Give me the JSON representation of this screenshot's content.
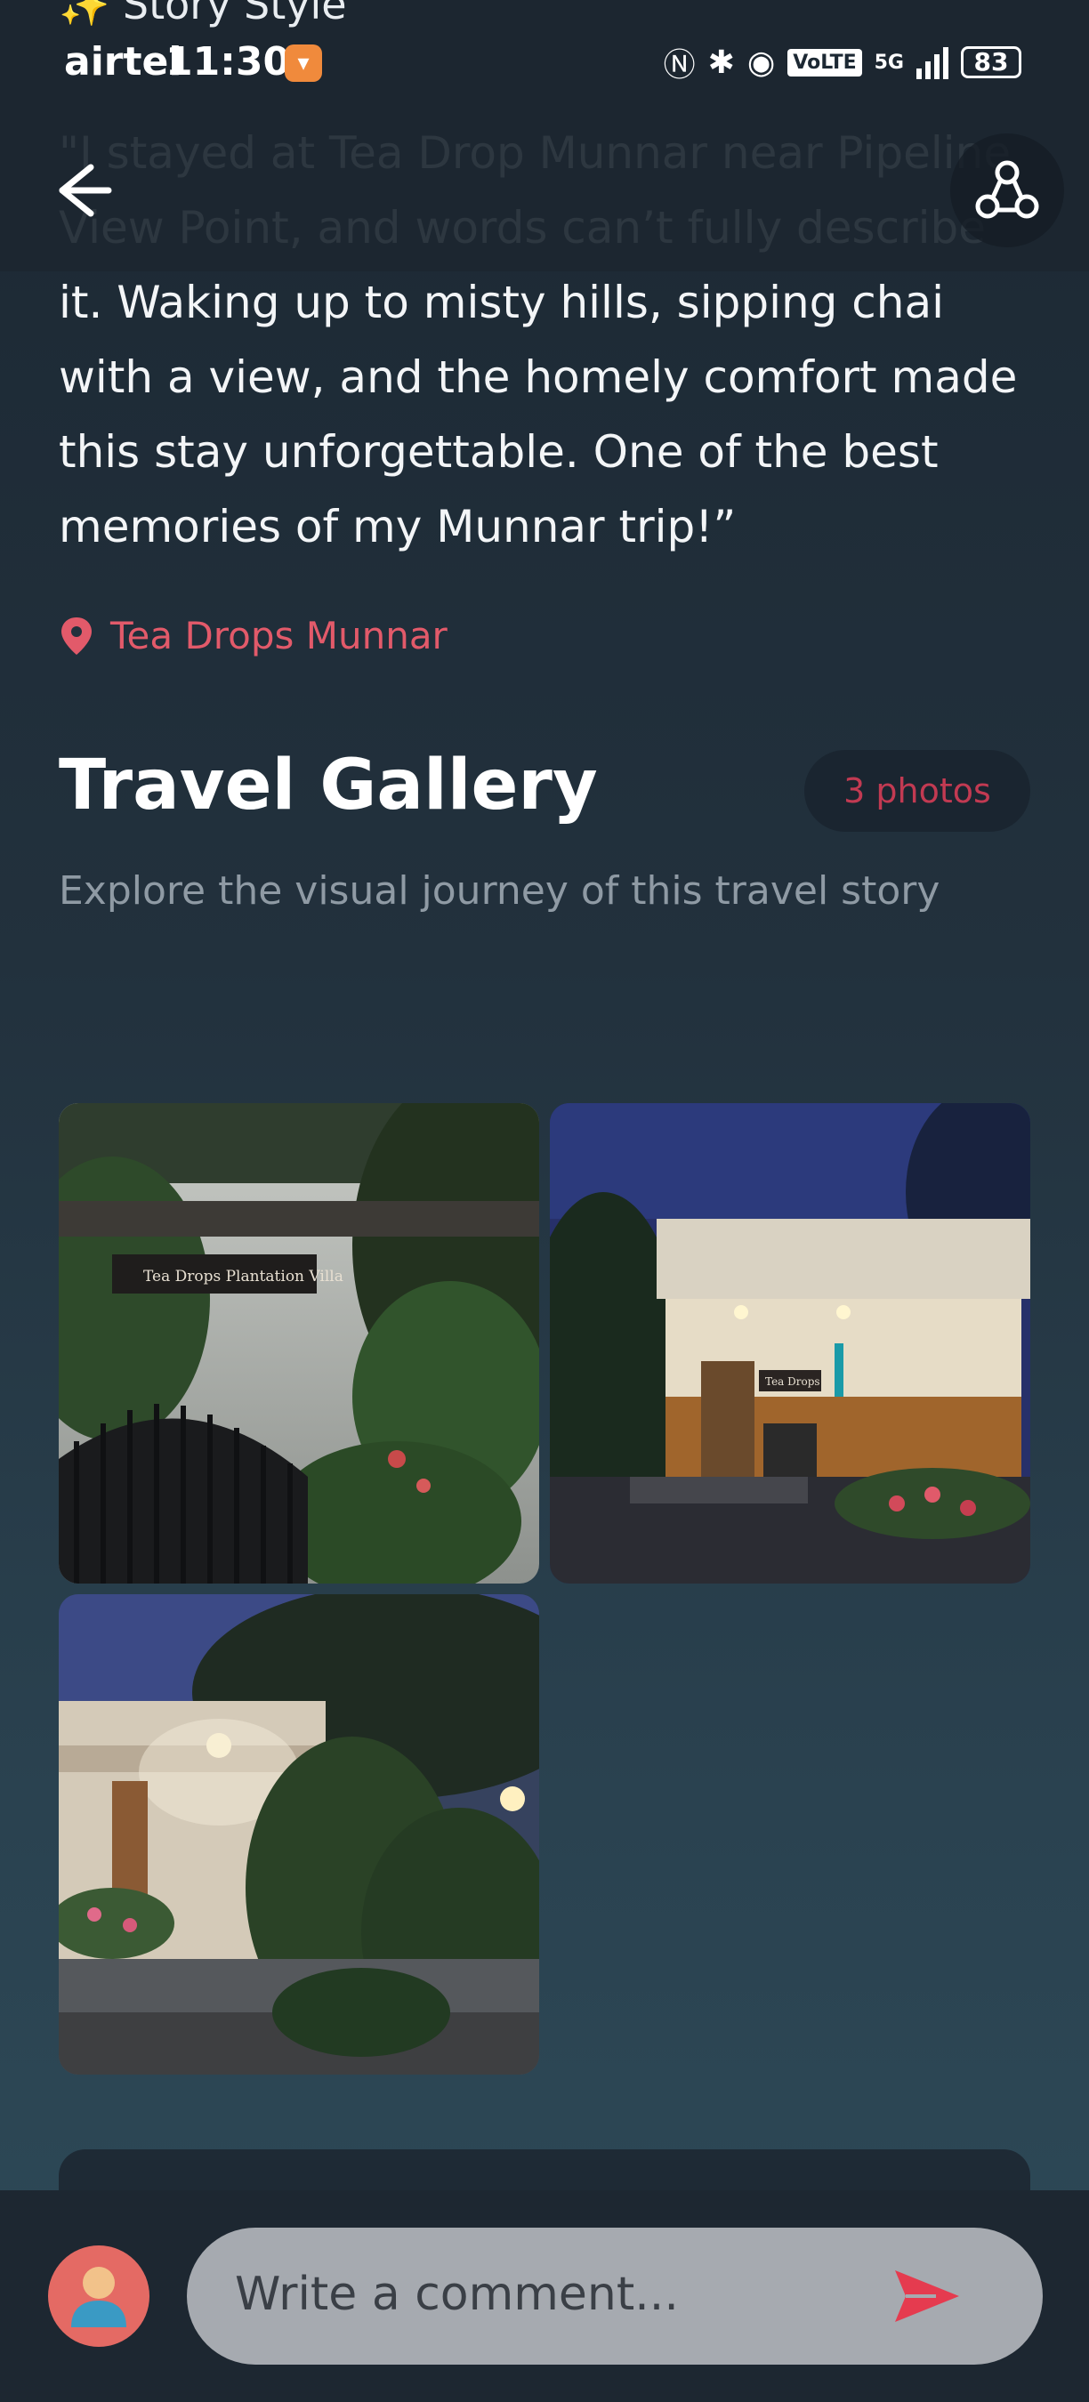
{
  "header": {
    "peek_title": "✨ Story Style",
    "status": {
      "carrier": "airtel",
      "time": "11:30",
      "network_tag": "VoLTE",
      "network_type": "5G",
      "battery": "83"
    }
  },
  "story": {
    "quote_text": "\"I stayed at Tea Drop Munnar near Pipeline\nView Point, and words can’t fully describe\nit. Waking up to misty hills, sipping chai\nwith a view, and the homely comfort made\nthis stay unforgettable. One of the best\nmemories of my Munnar trip!”",
    "location": "Tea Drops Munnar"
  },
  "gallery": {
    "title": "Travel Gallery",
    "count_label": "3 photos",
    "subtitle": "Explore the visual journey of this travel story",
    "photos": [
      {
        "label": "Tea Drops gate entrance in mist",
        "sign_text": "Tea Drops  Plantation Villa"
      },
      {
        "label": "Cottage porch at night",
        "sign_text": "Tea Drops"
      },
      {
        "label": "Garden path in rain at night",
        "sign_text": ""
      }
    ]
  },
  "comment": {
    "placeholder": "Write a comment..."
  },
  "colors": {
    "accent": "#e25a6a",
    "send": "#e53b4f",
    "avatar_bg": "#e46a64"
  }
}
